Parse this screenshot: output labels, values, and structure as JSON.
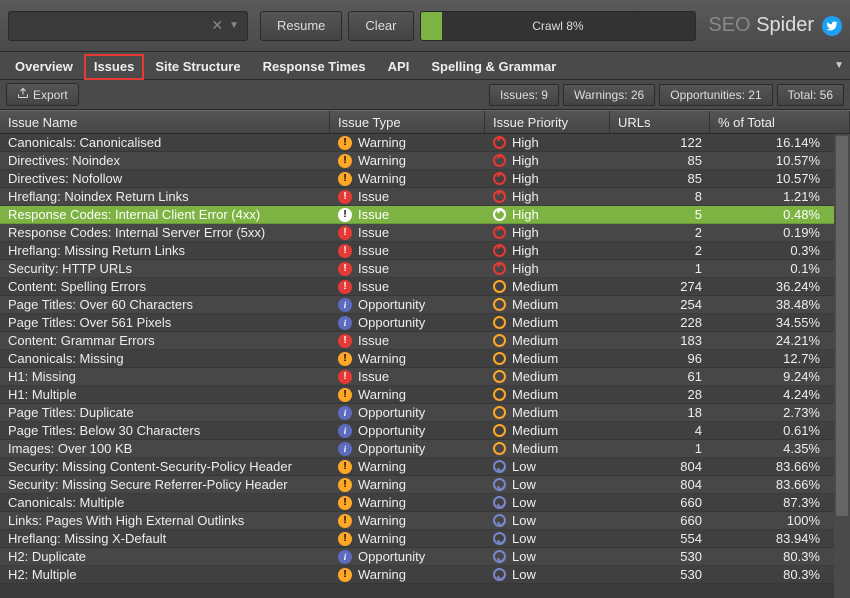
{
  "toolbar": {
    "resume": "Resume",
    "clear": "Clear",
    "progress_label": "Crawl 8%",
    "brand_prefix": "SEO",
    "brand_suffix": "Spider"
  },
  "tabs": [
    "Overview",
    "Issues",
    "Site Structure",
    "Response Times",
    "API",
    "Spelling & Grammar"
  ],
  "active_tab_index": 1,
  "export_label": "Export",
  "stats": {
    "issues": "Issues: 9",
    "warnings": "Warnings: 26",
    "opportunities": "Opportunities: 21",
    "total": "Total: 56"
  },
  "headers": {
    "name": "Issue Name",
    "type": "Issue Type",
    "priority": "Issue Priority",
    "urls": "URLs",
    "pct": "% of Total"
  },
  "rows": [
    {
      "name": "Canonicals: Canonicalised",
      "type": "Warning",
      "priority": "High",
      "urls": "122",
      "pct": "16.14%"
    },
    {
      "name": "Directives: Noindex",
      "type": "Warning",
      "priority": "High",
      "urls": "85",
      "pct": "10.57%"
    },
    {
      "name": "Directives: Nofollow",
      "type": "Warning",
      "priority": "High",
      "urls": "85",
      "pct": "10.57%"
    },
    {
      "name": "Hreflang: Noindex Return Links",
      "type": "Issue",
      "priority": "High",
      "urls": "8",
      "pct": "1.21%"
    },
    {
      "name": "Response Codes: Internal Client Error (4xx)",
      "type": "Issue",
      "priority": "High",
      "urls": "5",
      "pct": "0.48%",
      "selected": true
    },
    {
      "name": "Response Codes: Internal Server Error (5xx)",
      "type": "Issue",
      "priority": "High",
      "urls": "2",
      "pct": "0.19%"
    },
    {
      "name": "Hreflang: Missing Return Links",
      "type": "Issue",
      "priority": "High",
      "urls": "2",
      "pct": "0.3%"
    },
    {
      "name": "Security: HTTP URLs",
      "type": "Issue",
      "priority": "High",
      "urls": "1",
      "pct": "0.1%"
    },
    {
      "name": "Content: Spelling Errors",
      "type": "Issue",
      "priority": "Medium",
      "urls": "274",
      "pct": "36.24%"
    },
    {
      "name": "Page Titles: Over 60 Characters",
      "type": "Opportunity",
      "priority": "Medium",
      "urls": "254",
      "pct": "38.48%"
    },
    {
      "name": "Page Titles: Over 561 Pixels",
      "type": "Opportunity",
      "priority": "Medium",
      "urls": "228",
      "pct": "34.55%"
    },
    {
      "name": "Content: Grammar Errors",
      "type": "Issue",
      "priority": "Medium",
      "urls": "183",
      "pct": "24.21%"
    },
    {
      "name": "Canonicals: Missing",
      "type": "Warning",
      "priority": "Medium",
      "urls": "96",
      "pct": "12.7%"
    },
    {
      "name": "H1: Missing",
      "type": "Issue",
      "priority": "Medium",
      "urls": "61",
      "pct": "9.24%"
    },
    {
      "name": "H1: Multiple",
      "type": "Warning",
      "priority": "Medium",
      "urls": "28",
      "pct": "4.24%"
    },
    {
      "name": "Page Titles: Duplicate",
      "type": "Opportunity",
      "priority": "Medium",
      "urls": "18",
      "pct": "2.73%"
    },
    {
      "name": "Page Titles: Below 30 Characters",
      "type": "Opportunity",
      "priority": "Medium",
      "urls": "4",
      "pct": "0.61%"
    },
    {
      "name": "Images: Over 100 KB",
      "type": "Opportunity",
      "priority": "Medium",
      "urls": "1",
      "pct": "4.35%"
    },
    {
      "name": "Security: Missing Content-Security-Policy Header",
      "type": "Warning",
      "priority": "Low",
      "urls": "804",
      "pct": "83.66%"
    },
    {
      "name": "Security: Missing Secure Referrer-Policy Header",
      "type": "Warning",
      "priority": "Low",
      "urls": "804",
      "pct": "83.66%"
    },
    {
      "name": "Canonicals: Multiple",
      "type": "Warning",
      "priority": "Low",
      "urls": "660",
      "pct": "87.3%"
    },
    {
      "name": "Links: Pages With High External Outlinks",
      "type": "Warning",
      "priority": "Low",
      "urls": "660",
      "pct": "100%"
    },
    {
      "name": "Hreflang: Missing X-Default",
      "type": "Warning",
      "priority": "Low",
      "urls": "554",
      "pct": "83.94%"
    },
    {
      "name": "H2: Duplicate",
      "type": "Opportunity",
      "priority": "Low",
      "urls": "530",
      "pct": "80.3%"
    },
    {
      "name": "H2: Multiple",
      "type": "Warning",
      "priority": "Low",
      "urls": "530",
      "pct": "80.3%"
    }
  ]
}
